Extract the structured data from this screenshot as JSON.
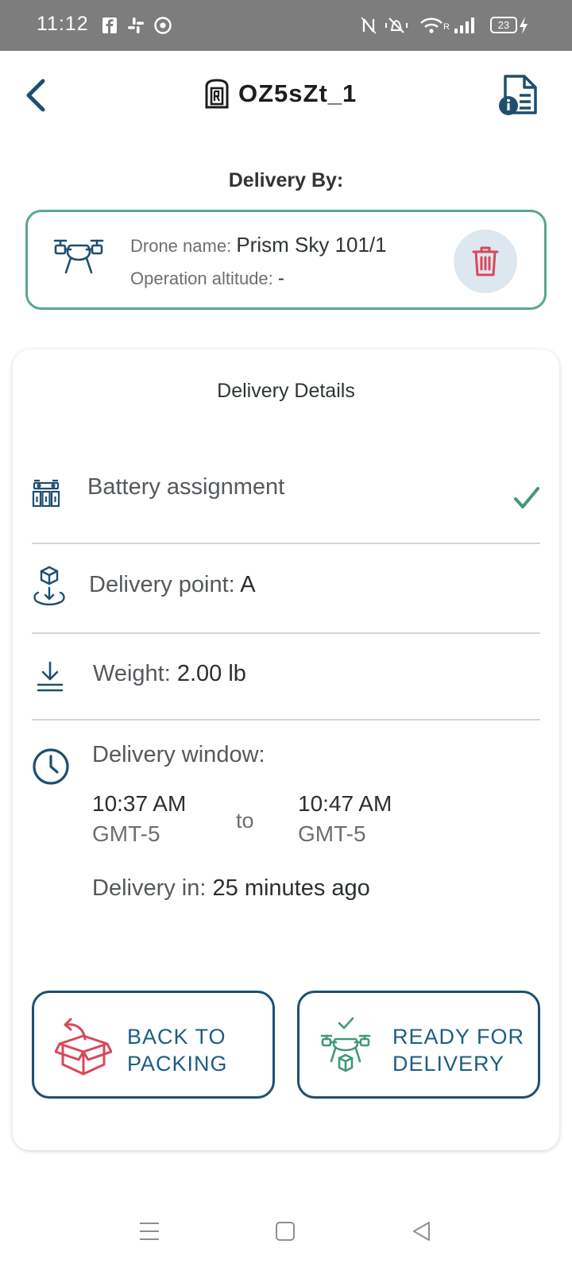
{
  "status_bar": {
    "time": "11:12",
    "battery_level": "23",
    "icons": [
      "facebook-icon",
      "slack-icon",
      "chrome-icon",
      "nfc-icon",
      "vibrate-icon",
      "wifi-icon",
      "signal-icon",
      "battery-icon",
      "charging-icon"
    ]
  },
  "header": {
    "title": "OZ5sZt_1",
    "back_icon": "chevron-left-icon",
    "title_icon": "locker-icon",
    "info_icon": "document-info-icon"
  },
  "delivery_by": {
    "label": "Delivery By:",
    "drone_name_label": "Drone name:",
    "drone_name_value": "Prism Sky 101/1",
    "altitude_label": "Operation altitude:",
    "altitude_value": "-",
    "drone_icon": "drone-icon",
    "delete_icon": "trash-icon"
  },
  "details": {
    "title": "Delivery Details",
    "battery": {
      "label": "Battery assignment",
      "icon": "battery-pack-icon",
      "status_icon": "checkmark-icon"
    },
    "delivery_point": {
      "label": "Delivery point:",
      "value": "A",
      "icon": "package-drop-icon"
    },
    "weight": {
      "label": "Weight:",
      "value": "2.00 lb",
      "icon": "weight-download-icon"
    },
    "window": {
      "label": "Delivery window:",
      "icon": "clock-icon",
      "start_time": "10:37 AM",
      "start_tz": "GMT-5",
      "separator": "to",
      "end_time": "10:47 AM",
      "end_tz": "GMT-5",
      "delivery_in_label": "Delivery in:",
      "delivery_in_value": "25 minutes ago"
    }
  },
  "actions": {
    "back_to_packing": {
      "line1": "BACK TO",
      "line2": "PACKING",
      "icon": "return-box-icon"
    },
    "ready_for_delivery": {
      "line1": "READY FOR",
      "line2": "DELIVERY",
      "icon": "drone-ready-icon"
    }
  },
  "colors": {
    "accent_navy": "#1e4f6f",
    "accent_blue_text": "#1e5d82",
    "card_border_green": "#5aa88a",
    "check_green": "#3f9a73",
    "danger_red": "#d9475a",
    "status_bar_gray": "#7d7d7d"
  }
}
